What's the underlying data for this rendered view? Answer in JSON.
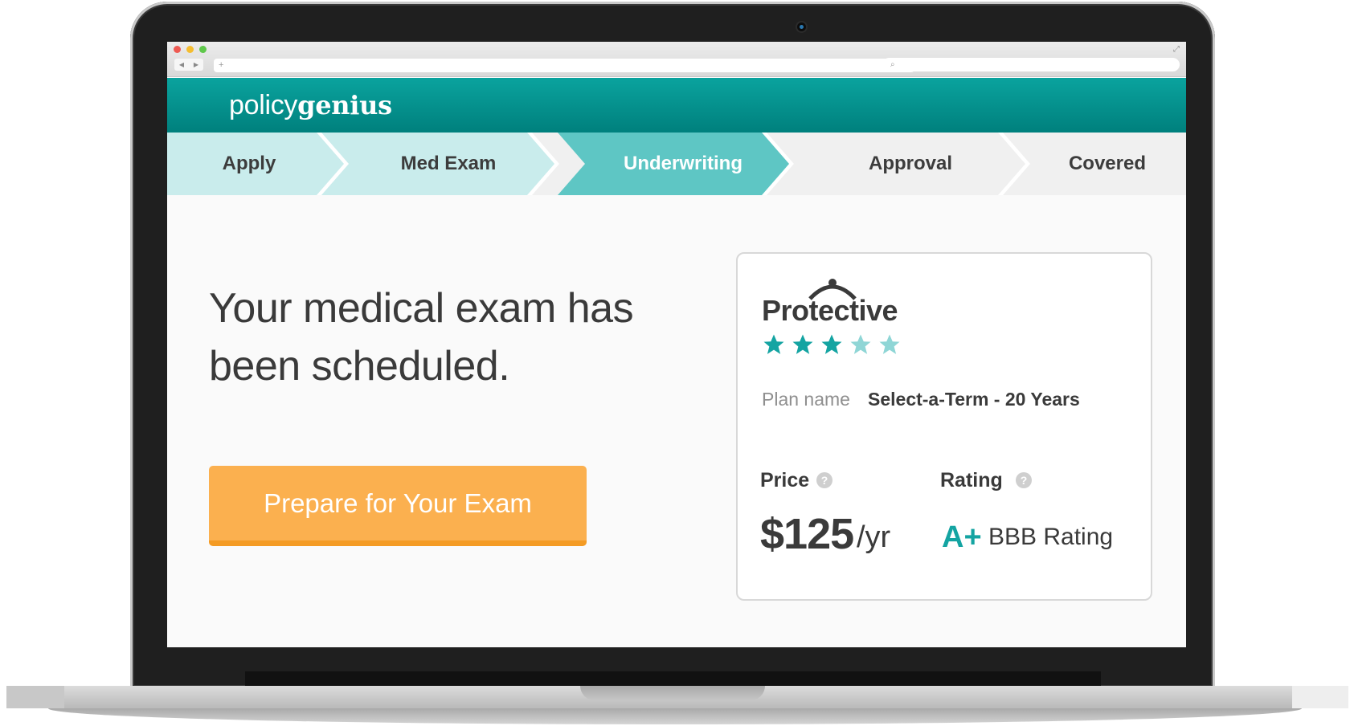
{
  "browser": {
    "url_placeholder": "+",
    "search_placeholder": "⌕",
    "back_icon": "◀",
    "forward_icon": "▶"
  },
  "header": {
    "logo_light": "policy",
    "logo_bold": "genius"
  },
  "steps": [
    {
      "label": "Apply",
      "state": "done"
    },
    {
      "label": "Med Exam",
      "state": "done"
    },
    {
      "label": "Underwriting",
      "state": "active"
    },
    {
      "label": "Approval",
      "state": "todo"
    },
    {
      "label": "Covered",
      "state": "todo"
    }
  ],
  "main": {
    "headline": "Your medical exam has been scheduled.",
    "cta_label": "Prepare for Your Exam"
  },
  "card": {
    "brand": "Protective",
    "stars_filled": 3,
    "stars_total": 5,
    "plan_label": "Plan name",
    "plan_value": "Select-a-Term - 20 Years",
    "price_label": "Price",
    "price_amount": "$125",
    "price_unit": "/yr",
    "rating_label": "Rating",
    "rating_grade": "A+",
    "rating_text": "BBB Rating",
    "help_glyph": "?"
  },
  "colors": {
    "teal": "#0aa39e",
    "teal_light": "#c9ecec",
    "teal_active": "#5ec6c4",
    "cta": "#fbb04f",
    "star_filled": "#14a4a2",
    "star_empty": "#8fd6d6"
  }
}
